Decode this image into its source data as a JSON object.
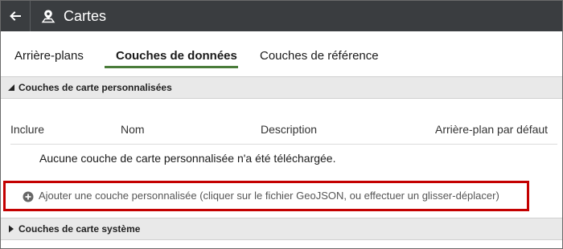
{
  "titlebar": {
    "back_icon": "arrow-left-icon",
    "map_icon": "map-marker-icon",
    "title": "Cartes"
  },
  "tabs": [
    {
      "label": "Arrière-plans",
      "active": false
    },
    {
      "label": "Couches de données",
      "active": true
    },
    {
      "label": "Couches de référence",
      "active": false
    }
  ],
  "custom_section": {
    "title": "Couches de carte personnalisées",
    "expanded": true,
    "columns": [
      "Inclure",
      "Nom",
      "Description",
      "Arrière-plan par défaut"
    ],
    "empty_message": "Aucune couche de carte personnalisée n'a été téléchargée.",
    "add_label": "Ajouter une couche personnalisée (cliquer sur le fichier GeoJSON, ou effectuer un glisser-déplacer)",
    "highlight_color": "#c40000"
  },
  "system_section": {
    "title": "Couches de carte système",
    "expanded": false
  },
  "colors": {
    "titlebar_bg": "#3a3d40",
    "tab_underline": "#4a7c3a",
    "section_header_bg": "#e9e9e9"
  }
}
